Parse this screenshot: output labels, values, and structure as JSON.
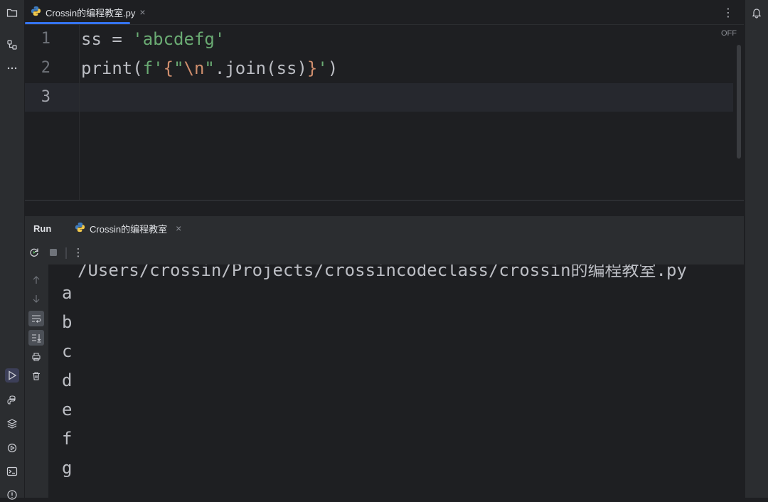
{
  "editor_tab": {
    "title": "Crossin的编程教室.py",
    "close": "×",
    "icon": "python-icon"
  },
  "editor": {
    "inspection_label": "OFF",
    "lines": [
      {
        "number": "1",
        "parts": [
          {
            "t": "ss = "
          },
          {
            "t": "'abcdefg'",
            "k": "str"
          }
        ]
      },
      {
        "number": "2",
        "parts": [
          {
            "t": "print("
          },
          {
            "t": "f'",
            "k": "str"
          },
          {
            "t": "{",
            "k": "brace"
          },
          {
            "t": "\"",
            "k": "str"
          },
          {
            "t": "\\n",
            "k": "esc"
          },
          {
            "t": "\"",
            "k": "str"
          },
          {
            "t": ".join(ss)"
          },
          {
            "t": "}",
            "k": "brace"
          },
          {
            "t": "'",
            "k": "str"
          },
          {
            "t": ")"
          }
        ]
      },
      {
        "number": "3",
        "parts": []
      }
    ],
    "current_line": 3
  },
  "run_panel": {
    "title": "Run",
    "tab_label": "Crossin的编程教室",
    "tab_close": "×",
    "more_menu": "⋮",
    "console_path": "/Users/crossin/Projects/crossincodeclass/crossin的编程教室.py",
    "output": [
      "a",
      "b",
      "c",
      "d",
      "e",
      "f",
      "g"
    ]
  },
  "tab_bar": {
    "more_menu": "⋮"
  },
  "left_strip_icons": [
    "folder-icon",
    "structure-icon",
    "more-icon",
    "run-icon",
    "python-console-icon",
    "layers-icon",
    "services-icon",
    "terminal-icon",
    "problems-icon"
  ],
  "right_strip_icons": [
    "notifications-icon"
  ],
  "colors": {
    "accent": "#3574f0",
    "string": "#6aab73",
    "keyword": "#cf8e6d"
  }
}
